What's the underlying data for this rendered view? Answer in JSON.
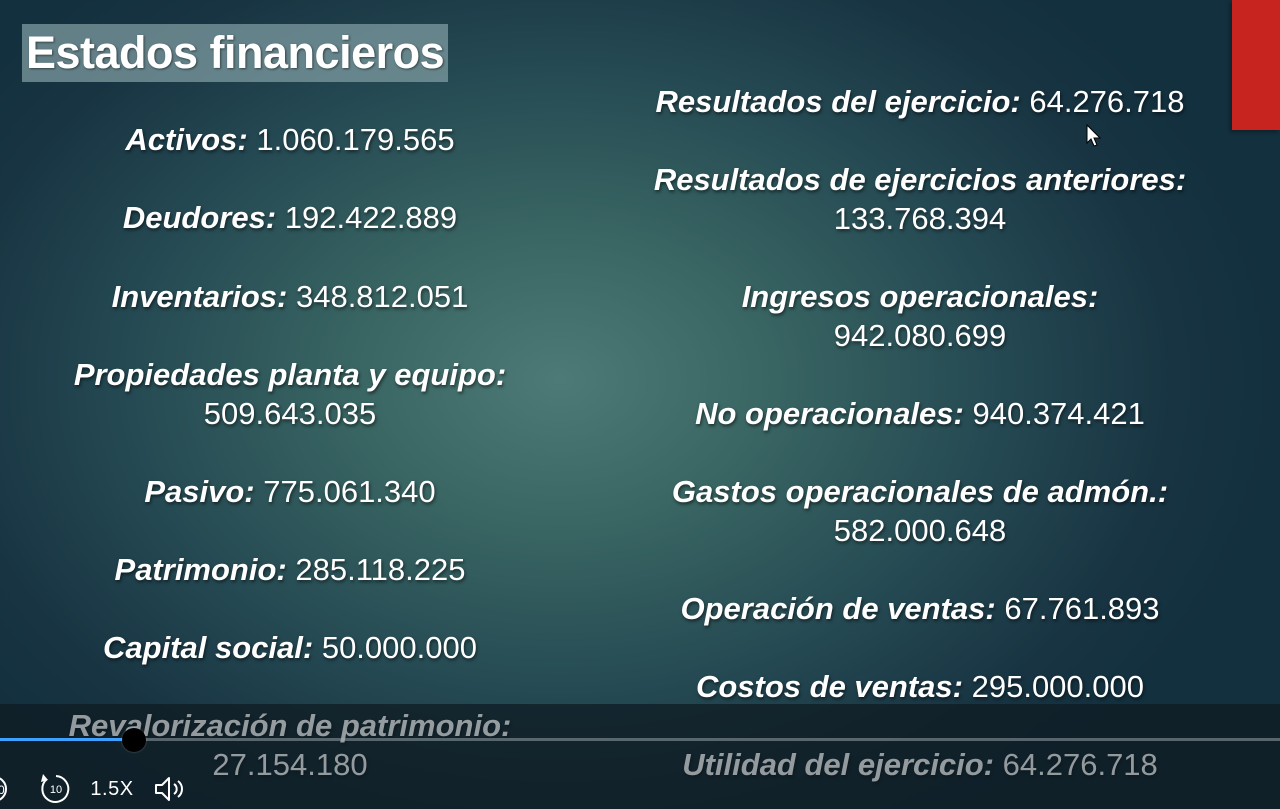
{
  "slide": {
    "title": "Estados financieros",
    "left_items": [
      {
        "label": "Activos:",
        "value": "1.060.179.565"
      },
      {
        "label": "Deudores:",
        "value": "192.422.889"
      },
      {
        "label": "Inventarios:",
        "value": "348.812.051"
      },
      {
        "label": "Propiedades planta y equipo:",
        "value": "509.643.035"
      },
      {
        "label": "Pasivo:",
        "value": "775.061.340"
      },
      {
        "label": "Patrimonio:",
        "value": "285.118.225"
      },
      {
        "label": "Capital social:",
        "value": "50.000.000"
      },
      {
        "label": "Revalorización de patrimonio:",
        "value": "27.154.180"
      }
    ],
    "right_items": [
      {
        "label": "Resultados del ejercicio:",
        "value": "64.276.718"
      },
      {
        "label": "Resultados de ejercicios anteriores:",
        "value": "133.768.394"
      },
      {
        "label": "Ingresos operacionales:",
        "value": "942.080.699"
      },
      {
        "label": "No operacionales:",
        "value": "940.374.421"
      },
      {
        "label": "Gastos operacionales de admón.:",
        "value": "582.000.648"
      },
      {
        "label": "Operación de ventas:",
        "value": "67.761.893"
      },
      {
        "label": "Costos de ventas:",
        "value": "295.000.000"
      },
      {
        "label": "Utilidad del ejercicio:",
        "value": "64.276.718"
      }
    ]
  },
  "player": {
    "speed_label": "1.5X",
    "skip_back_label": "10",
    "progress_fraction": 0.105,
    "icons": [
      "play-icon",
      "rewind-10-icon",
      "volume-icon"
    ],
    "accent_color": "#3ea0ff"
  }
}
